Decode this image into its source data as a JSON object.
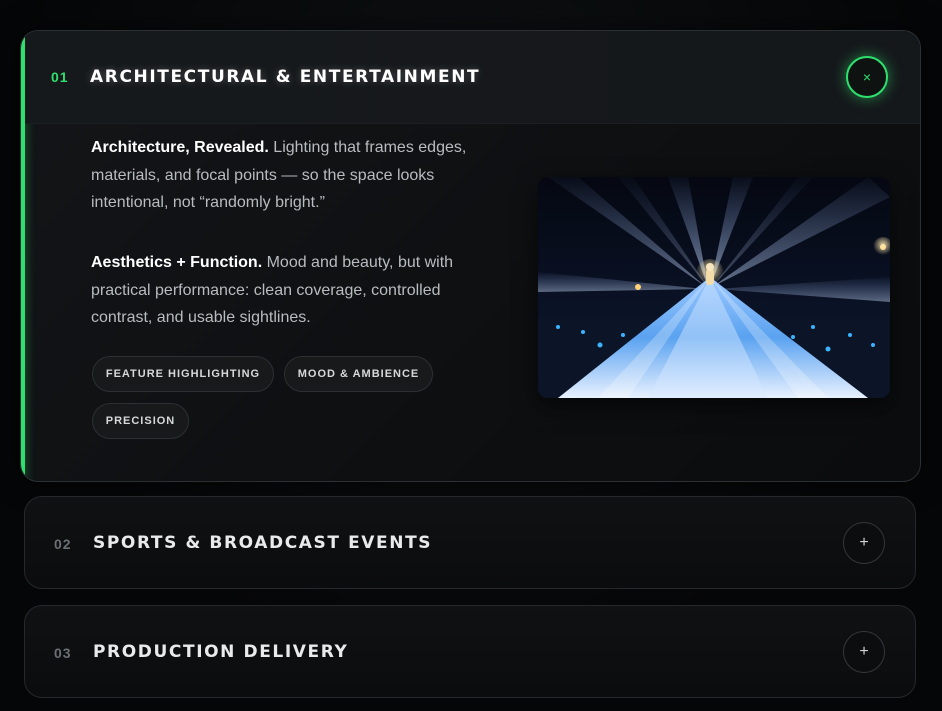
{
  "panels": [
    {
      "number": "01",
      "title": "ARCHITECTURAL & ENTERTAINMENT",
      "state": "expanded",
      "toggle_icon": "close-icon",
      "toggle_symbol": "×",
      "paragraphs": [
        {
          "lead": "Architecture, Revealed.",
          "text": " Lighting that frames edges, materials, and focal points — so the space looks intentional, not “randomly bright.”"
        },
        {
          "lead": "Aesthetics + Function.",
          "text": " Mood and beauty, but with practical performance: clean coverage, controlled contrast, and usable sightlines."
        }
      ],
      "tags": [
        "FEATURE HIGHLIGHTING",
        "MOOD & AMBIENCE",
        "PRECISION"
      ],
      "image_alt": "illuminated-stage-with-light-beams"
    },
    {
      "number": "02",
      "title": "SPORTS & BROADCAST EVENTS",
      "state": "collapsed",
      "toggle_icon": "plus-icon",
      "toggle_symbol": "+"
    },
    {
      "number": "03",
      "title": "PRODUCTION DELIVERY",
      "state": "collapsed",
      "toggle_icon": "plus-icon",
      "toggle_symbol": "+"
    }
  ],
  "colors": {
    "accent": "#2ee06e",
    "background": "#050607",
    "panel": "#0f1113",
    "text_primary": "#ffffff",
    "text_secondary": "#b9bcbf"
  }
}
